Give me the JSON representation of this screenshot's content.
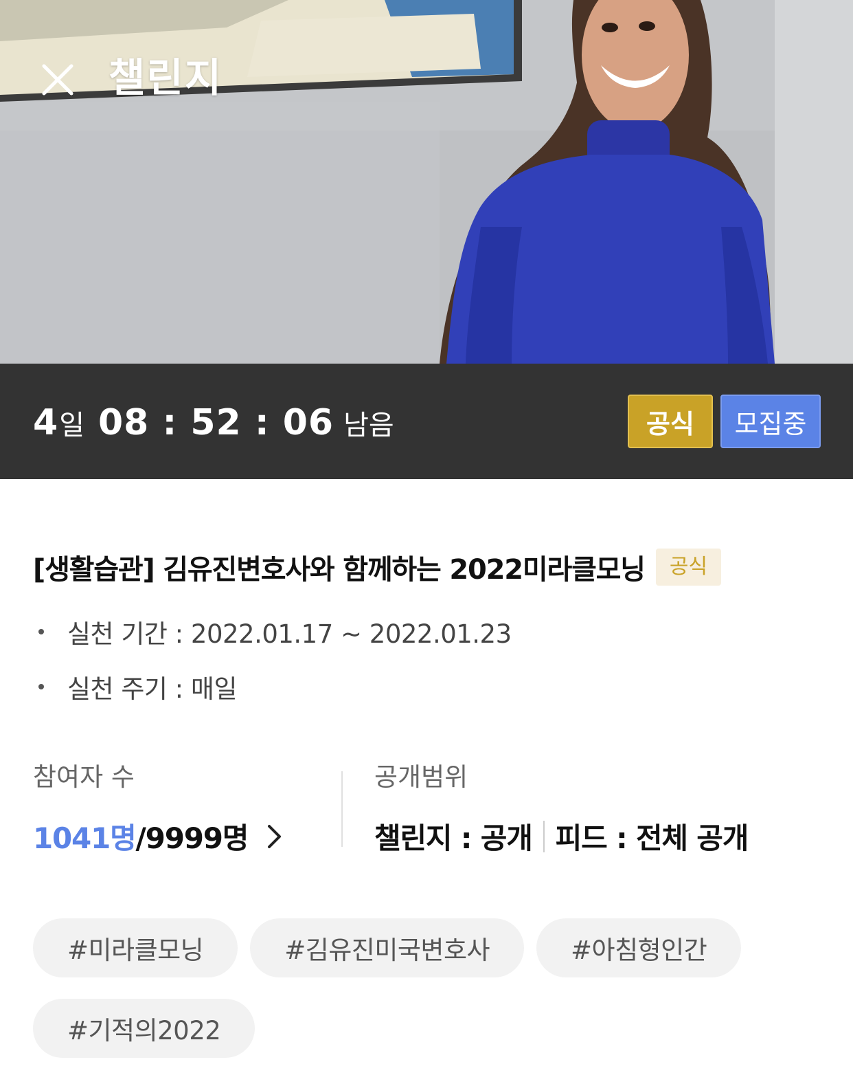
{
  "header": {
    "title": "챌린지",
    "close_icon": "close-icon"
  },
  "countdown": {
    "days": "4",
    "days_unit": "일",
    "time": "08 : 52 : 06",
    "suffix": "남음"
  },
  "badges": {
    "official": "공식",
    "recruiting": "모집중",
    "official_color": "#c9a227",
    "recruiting_color": "#5b83e6"
  },
  "challenge": {
    "title": "[생활습관] 김유진변호사와 함께하는 2022미라클모닝",
    "tag": "공식",
    "period": "실천 기간 : 2022.01.17 ~ 2022.01.23",
    "cycle": "실천 주기 : 매일"
  },
  "participants": {
    "label": "참여자 수",
    "current": "1041명",
    "max": "/9999명"
  },
  "visibility": {
    "label": "공개범위",
    "challenge": "챌린지 : 공개",
    "feed": "피드 : 전체 공개"
  },
  "hashtags": [
    "#미라클모닝",
    "#김유진미국변호사",
    "#아침형인간",
    "#기적의2022"
  ],
  "colors": {
    "countdown_bg": "#333333",
    "accent_blue": "#5b83e6",
    "accent_gold": "#c9a227",
    "tag_bg": "#f2f2f2"
  }
}
